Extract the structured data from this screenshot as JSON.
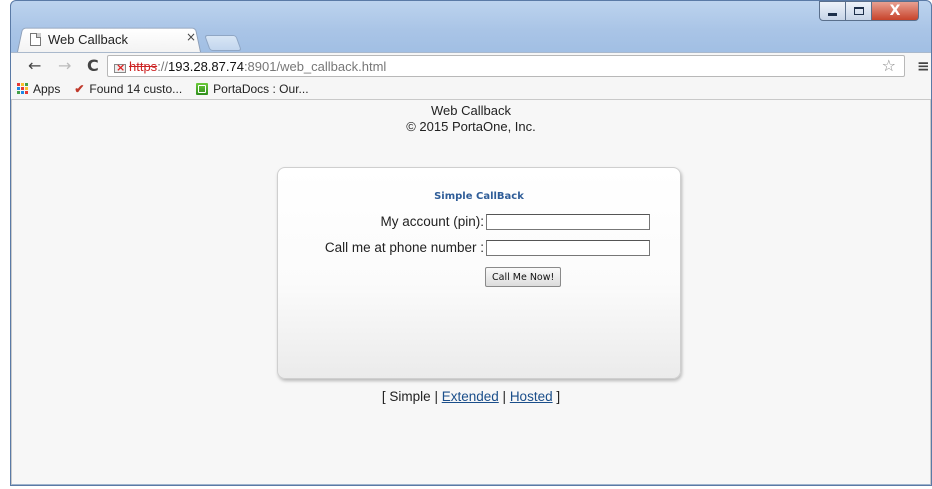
{
  "browser": {
    "tab": {
      "title": "Web Callback",
      "close": "×"
    },
    "window_controls": {
      "close": "X"
    },
    "nav": {
      "back": "←",
      "forward": "→",
      "reload": "C"
    },
    "url": {
      "scheme": "https",
      "sep": "://",
      "host": "193.28.87.74",
      "path": ":8901/web_callback.html"
    },
    "menu": "≡",
    "star": "☆",
    "bookmarks": [
      {
        "label": "Apps",
        "icon": "apps-grid-icon"
      },
      {
        "label": "Found 14 custo...",
        "icon": "checkmark-icon"
      },
      {
        "label": "PortaDocs : Our...",
        "icon": "portadocs-icon"
      }
    ]
  },
  "page": {
    "header_title": "Web Callback",
    "header_copyright": "© 2015 PortaOne, Inc.",
    "form": {
      "title": "Simple CallBack",
      "pin_label": "My account (pin):",
      "pin_value": "",
      "phone_label": "Call me at phone number :",
      "phone_value": "",
      "submit_label": "Call Me Now!"
    },
    "links": {
      "open": "[",
      "simple": "Simple",
      "sep1": "|",
      "extended": "Extended",
      "sep2": "|",
      "hosted": "Hosted",
      "close": "]"
    }
  },
  "colors": {
    "accent": "#2f5d98",
    "link": "#1a4e8a",
    "insecure": "#c22222"
  }
}
